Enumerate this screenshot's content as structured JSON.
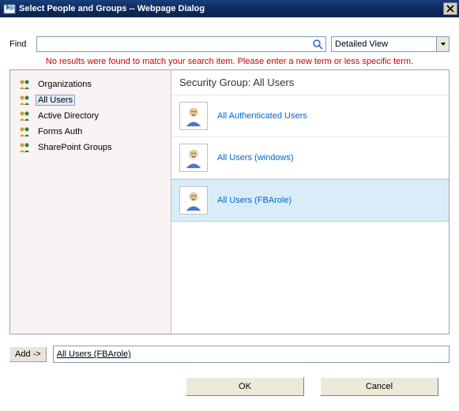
{
  "titlebar": {
    "title": "Select People and Groups -- Webpage Dialog"
  },
  "find": {
    "label": "Find",
    "value": "",
    "searchIconName": "search-icon"
  },
  "view": {
    "selected": "Detailed View"
  },
  "error": "No results were found to match your search item. Please enter a new term or less specific term.",
  "tree": {
    "items": [
      {
        "label": "Organizations",
        "selected": false
      },
      {
        "label": "All Users",
        "selected": true
      },
      {
        "label": "Active Directory",
        "selected": false
      },
      {
        "label": "Forms Auth",
        "selected": false
      },
      {
        "label": "SharePoint Groups",
        "selected": false
      }
    ]
  },
  "results": {
    "header": "Security Group: All Users",
    "rows": [
      {
        "name": "All Authenticated Users",
        "selected": false
      },
      {
        "name": "All Users (windows)",
        "selected": false
      },
      {
        "name": "All Users (FBArole)",
        "selected": true
      }
    ]
  },
  "addRow": {
    "buttonLabel": "Add ->",
    "selectedText": "All Users (FBArole)"
  },
  "buttons": {
    "ok": "OK",
    "cancel": "Cancel"
  }
}
